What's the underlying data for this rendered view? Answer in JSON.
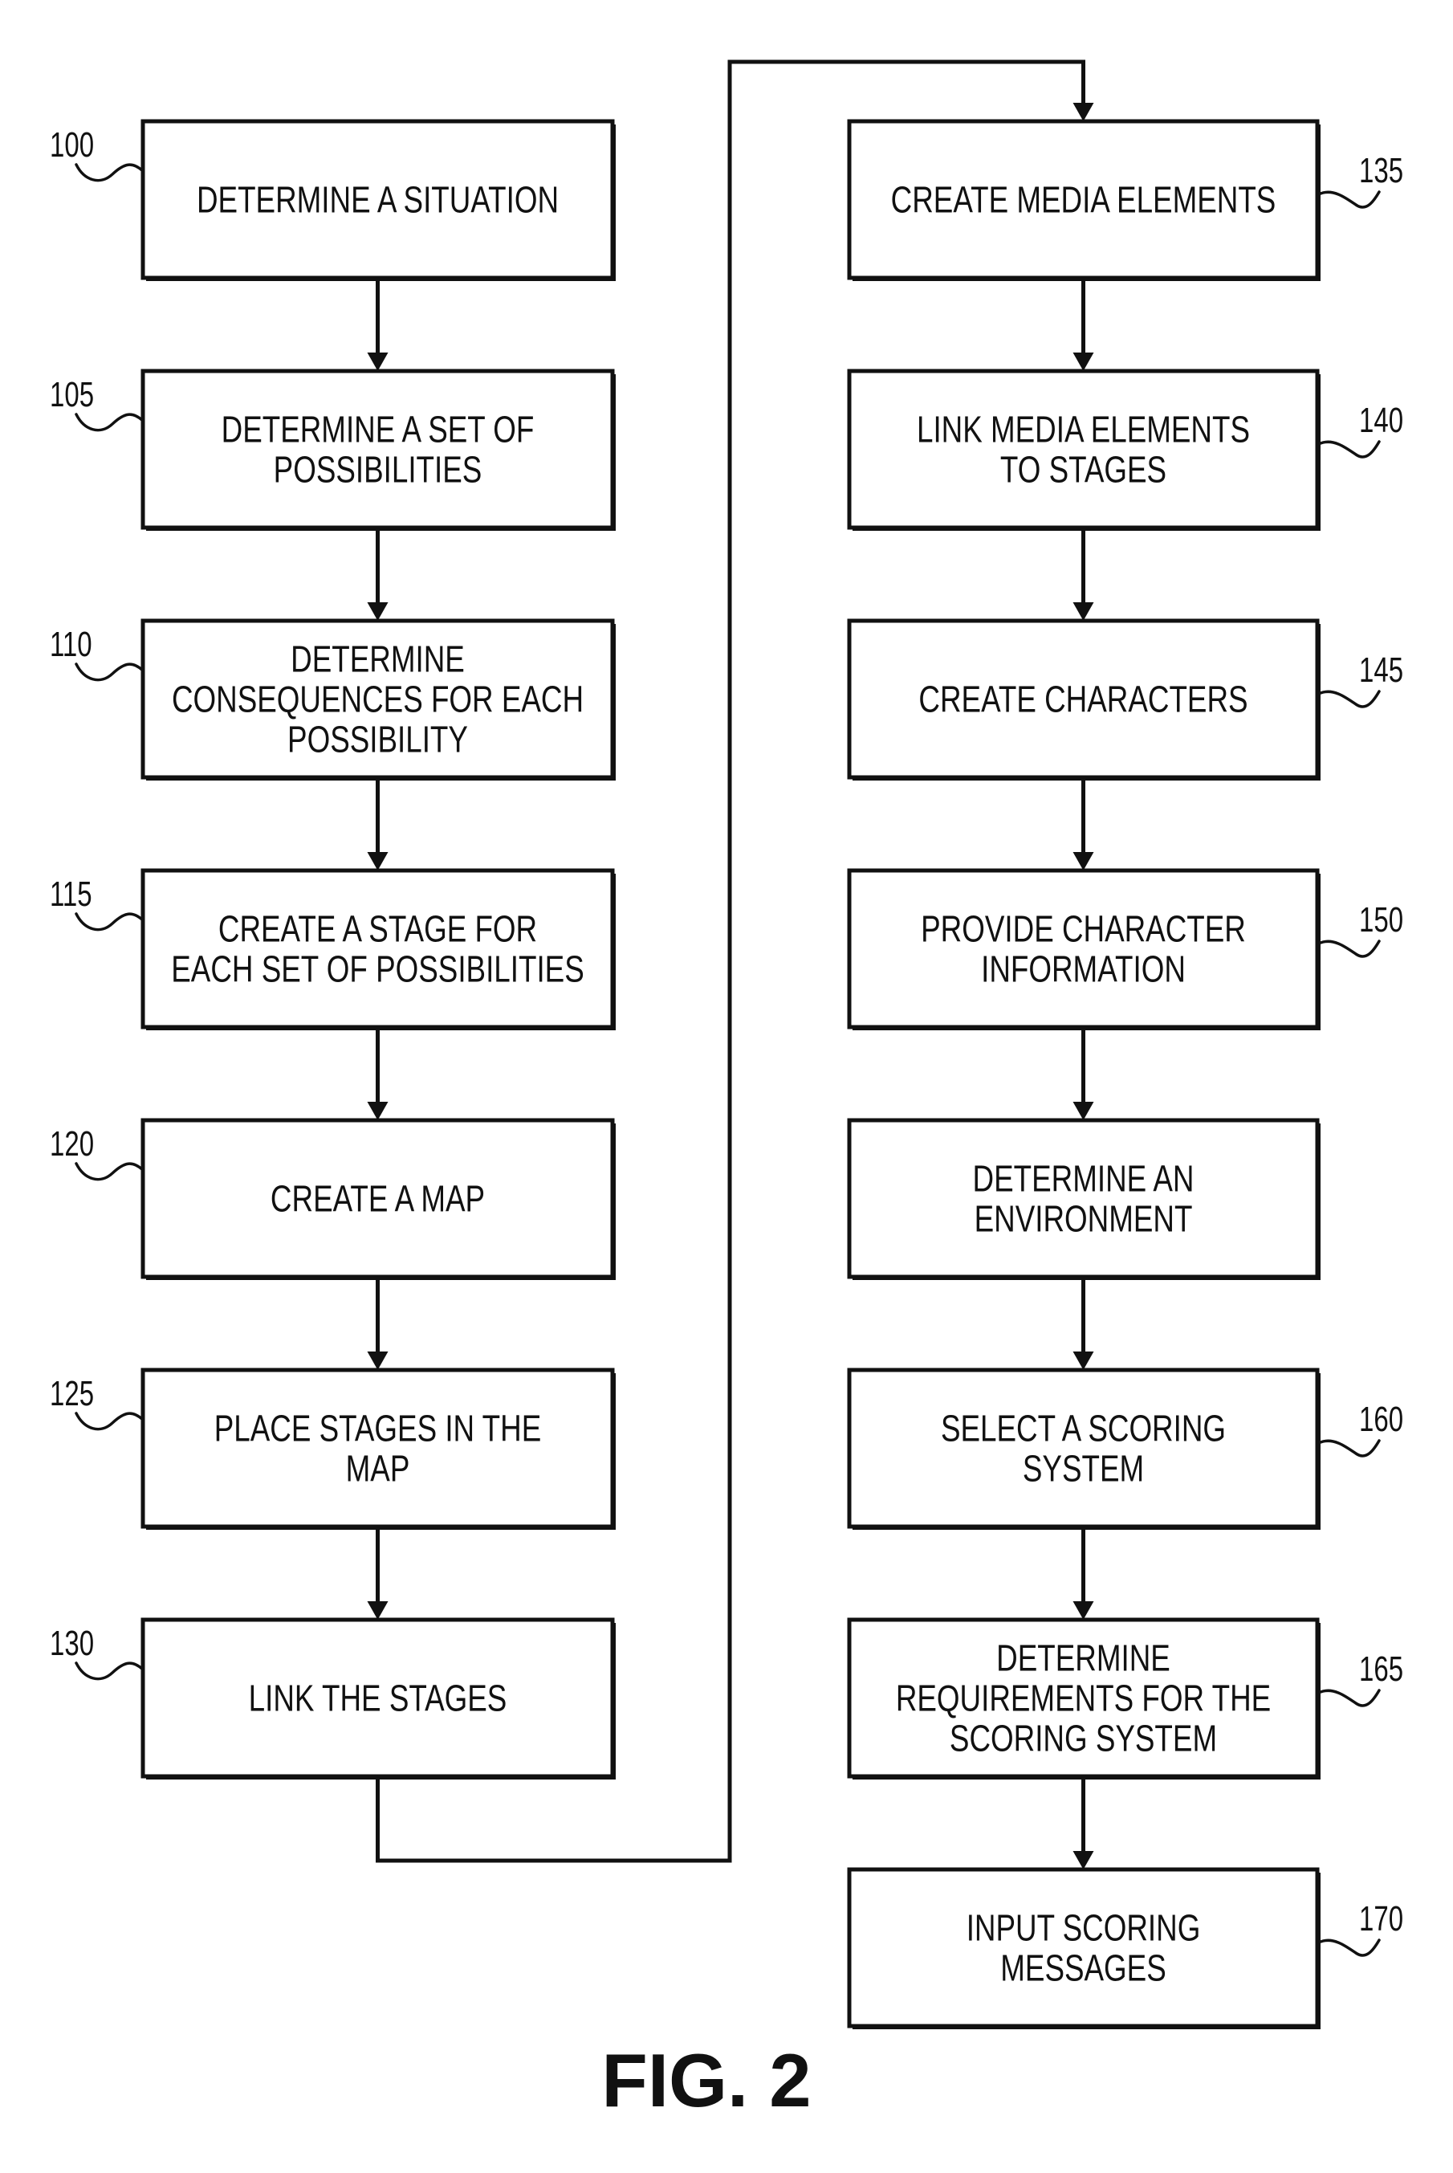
{
  "figure": {
    "caption": "FIG. 2",
    "colors": {
      "ink": "#111111",
      "background": "#ffffff"
    }
  },
  "flowchart": {
    "left_column": [
      {
        "ref": "100",
        "lines": [
          "DETERMINE A SITUATION"
        ]
      },
      {
        "ref": "105",
        "lines": [
          "DETERMINE A SET OF",
          "POSSIBILITIES"
        ]
      },
      {
        "ref": "110",
        "lines": [
          "DETERMINE",
          "CONSEQUENCES FOR EACH",
          "POSSIBILITY"
        ]
      },
      {
        "ref": "115",
        "lines": [
          "CREATE A STAGE FOR",
          "EACH SET OF POSSIBILITIES"
        ]
      },
      {
        "ref": "120",
        "lines": [
          "CREATE A MAP"
        ]
      },
      {
        "ref": "125",
        "lines": [
          "PLACE STAGES IN THE",
          "MAP"
        ]
      },
      {
        "ref": "130",
        "lines": [
          "LINK THE STAGES"
        ]
      }
    ],
    "right_column": [
      {
        "ref": "135",
        "lines": [
          "CREATE MEDIA ELEMENTS"
        ]
      },
      {
        "ref": "140",
        "lines": [
          "LINK MEDIA ELEMENTS",
          "TO STAGES"
        ]
      },
      {
        "ref": "145",
        "lines": [
          "CREATE CHARACTERS"
        ]
      },
      {
        "ref": "150",
        "lines": [
          "PROVIDE CHARACTER",
          "INFORMATION"
        ]
      },
      {
        "ref": "",
        "lines": [
          "DETERMINE AN",
          "ENVIRONMENT"
        ]
      },
      {
        "ref": "160",
        "lines": [
          "SELECT A SCORING",
          "SYSTEM"
        ]
      },
      {
        "ref": "165",
        "lines": [
          "DETERMINE",
          "REQUIREMENTS FOR THE",
          "SCORING SYSTEM"
        ]
      },
      {
        "ref": "170",
        "lines": [
          "INPUT SCORING",
          "MESSAGES"
        ]
      }
    ],
    "connections": [
      {
        "from": "100",
        "to": "105"
      },
      {
        "from": "105",
        "to": "110"
      },
      {
        "from": "110",
        "to": "115"
      },
      {
        "from": "115",
        "to": "120"
      },
      {
        "from": "120",
        "to": "125"
      },
      {
        "from": "125",
        "to": "130"
      },
      {
        "from": "130",
        "to": "135",
        "routing": "loop"
      },
      {
        "from": "135",
        "to": "140"
      },
      {
        "from": "140",
        "to": "145"
      },
      {
        "from": "145",
        "to": "150"
      },
      {
        "from": "150",
        "to": "DETERMINE AN ENVIRONMENT"
      },
      {
        "from": "DETERMINE AN ENVIRONMENT",
        "to": "160"
      },
      {
        "from": "160",
        "to": "165"
      },
      {
        "from": "165",
        "to": "170"
      }
    ]
  }
}
